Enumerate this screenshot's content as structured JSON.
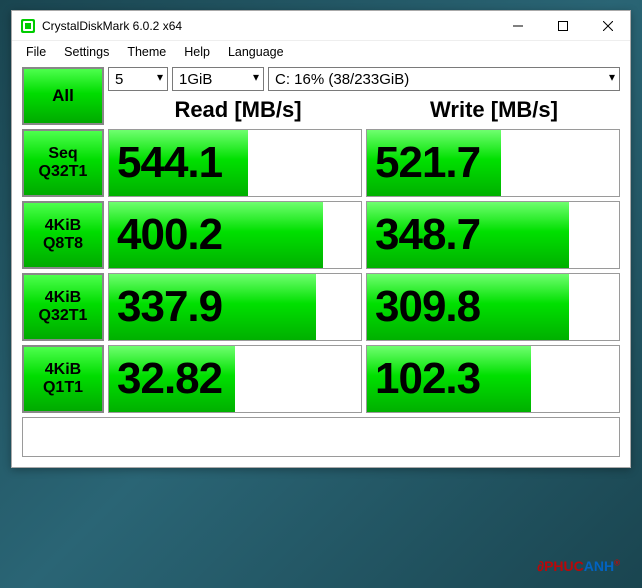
{
  "window": {
    "title": "CrystalDiskMark 6.0.2 x64"
  },
  "menu": {
    "file": "File",
    "settings": "Settings",
    "theme": "Theme",
    "help": "Help",
    "language": "Language"
  },
  "controls": {
    "all_label": "All",
    "runs": "5",
    "size": "1GiB",
    "drive": "C: 16% (38/233GiB)"
  },
  "headers": {
    "read": "Read [MB/s]",
    "write": "Write [MB/s]"
  },
  "tests": [
    {
      "label1": "Seq",
      "label2": "Q32T1",
      "read": "544.1",
      "write": "521.7",
      "rbar": 55,
      "wbar": 53
    },
    {
      "label1": "4KiB",
      "label2": "Q8T8",
      "read": "400.2",
      "write": "348.7",
      "rbar": 85,
      "wbar": 80
    },
    {
      "label1": "4KiB",
      "label2": "Q32T1",
      "read": "337.9",
      "write": "309.8",
      "rbar": 82,
      "wbar": 80
    },
    {
      "label1": "4KiB",
      "label2": "Q1T1",
      "read": "32.82",
      "write": "102.3",
      "rbar": 50,
      "wbar": 65
    }
  ],
  "watermark": "∂PHUCANH"
}
